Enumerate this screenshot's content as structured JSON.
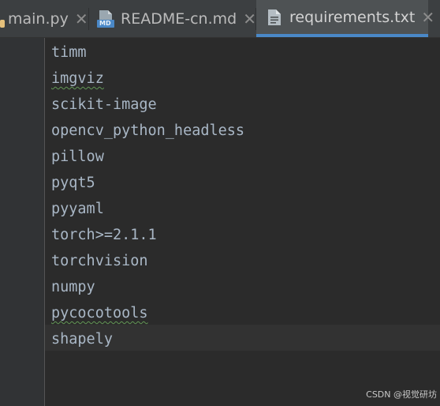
{
  "tabs": [
    {
      "label": "main.py",
      "icon": "python-file-icon"
    },
    {
      "label": "README-cn.md",
      "icon": "markdown-file-icon",
      "icon_text": "MD"
    },
    {
      "label": "requirements.txt",
      "icon": "text-file-icon",
      "active": true
    }
  ],
  "close_glyph": "✕",
  "editor": {
    "lines": [
      "timm",
      "imgviz",
      "scikit-image",
      "opencv_python_headless",
      "pillow",
      "pyqt5",
      "pyyaml",
      "torch>=2.1.1",
      "torchvision",
      "numpy",
      "pycocotools",
      "shapely"
    ],
    "current_line": 12
  },
  "watermark": "CSDN @视觉研坊",
  "colors": {
    "accent": "#4a88c7",
    "text": "#a9b7c6",
    "background": "#2b2b2b"
  }
}
